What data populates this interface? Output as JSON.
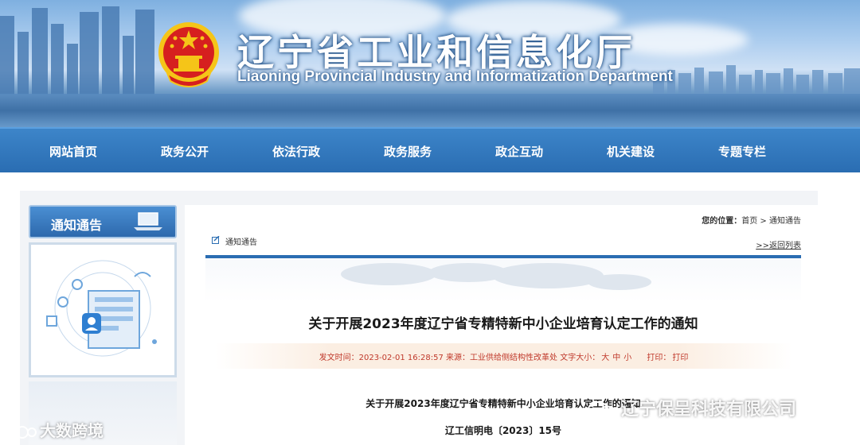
{
  "header": {
    "title_cn": "辽宁省工业和信息化厅",
    "title_en": "Liaoning Provincial Industry and Informatization Department"
  },
  "nav": {
    "items": [
      "网站首页",
      "政务公开",
      "依法行政",
      "政务服务",
      "政企互动",
      "机关建设",
      "专题专栏"
    ]
  },
  "sidebar": {
    "title": "通知通告"
  },
  "breadcrumb": {
    "label": "您的位置：",
    "home": "首页",
    "sep": ">",
    "current": "通知通告"
  },
  "section": {
    "label": "通知通告",
    "back_link": ">>返回列表"
  },
  "article": {
    "title": "关于开展2023年度辽宁省专精特新中小企业培育认定工作的通知",
    "meta": {
      "time_label": "发文时间：",
      "time": "2023-02-01 16:28:57",
      "source_label": "来源：",
      "source": "工业供给侧结构性改革处",
      "font_label": "文字大小：",
      "font_large": "大",
      "font_medium": "中",
      "font_small": "小",
      "print_label": "打印：",
      "print": "打印"
    },
    "subtitle": "关于开展2023年度辽宁省专精特新中小企业培育认定工作的通知",
    "doc_number": "辽工信明电〔2023〕15号"
  },
  "watermarks": {
    "left": "大数跨境",
    "right": "辽宁保呈科技有限公司"
  },
  "colors": {
    "nav_blue": "#2a6db2",
    "meta_red": "#c0392b",
    "emblem_red": "#d61f1f",
    "emblem_gold": "#f5c518"
  }
}
